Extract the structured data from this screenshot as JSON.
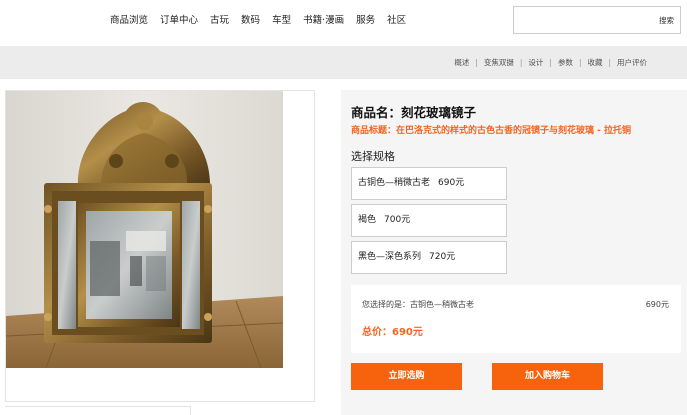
{
  "nav": {
    "links": [
      "商品浏览",
      "订单中心",
      "古玩",
      "数码",
      "车型",
      "书籍·漫画",
      "服务",
      "社区"
    ],
    "search_placeholder": "",
    "search_button": "搜索"
  },
  "tabs": [
    "概述",
    "变焦双摄",
    "设计",
    "参数",
    "收藏",
    "用户评价"
  ],
  "product": {
    "name": "商品名：刻花玻璃镜子",
    "subtitle": "商品标题：在巴洛克式的样式的古色古香的冠镜子与刻花玻璃 - 拉托铜"
  },
  "specs": {
    "title": "选择规格",
    "options": [
      {
        "label": "古铜色—稍微古老",
        "price": "690元"
      },
      {
        "label": "褐色",
        "price": "700元"
      },
      {
        "label": "黑色—深色系列",
        "price": "720元"
      }
    ]
  },
  "summary": {
    "selected_label": "您选择的是：古铜色—稍微古老",
    "selected_price": "690元",
    "total": "总价：690元"
  },
  "actions": {
    "buy": "立即选购",
    "cart": "加入购物车"
  },
  "colors": {
    "accent": "#f7630c",
    "accent_text": "#f26522"
  },
  "image": {
    "icon": "ornate-mirror-photo"
  }
}
